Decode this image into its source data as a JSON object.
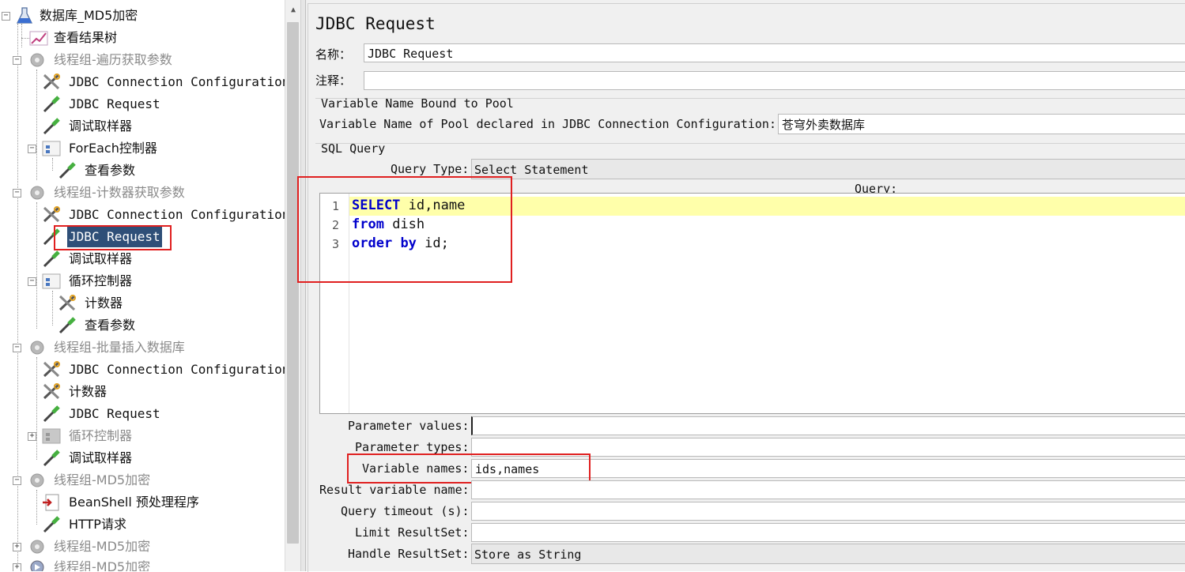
{
  "tree": {
    "root": "数据库_MD5加密",
    "items": [
      {
        "label": "查看结果树"
      },
      {
        "label": "线程组-遍历获取参数"
      },
      {
        "label": "JDBC Connection Configuration"
      },
      {
        "label": "JDBC Request"
      },
      {
        "label": "调试取样器"
      },
      {
        "label": "ForEach控制器"
      },
      {
        "label": "查看参数"
      },
      {
        "label": "线程组-计数器获取参数"
      },
      {
        "label": "JDBC Connection Configuration"
      },
      {
        "label": "JDBC Request"
      },
      {
        "label": "调试取样器"
      },
      {
        "label": "循环控制器"
      },
      {
        "label": "计数器"
      },
      {
        "label": "查看参数"
      },
      {
        "label": "线程组-批量插入数据库"
      },
      {
        "label": "JDBC Connection Configuration"
      },
      {
        "label": "计数器"
      },
      {
        "label": "JDBC Request"
      },
      {
        "label": "循环控制器"
      },
      {
        "label": "调试取样器"
      },
      {
        "label": "线程组-MD5加密"
      },
      {
        "label": "BeanShell 预处理程序"
      },
      {
        "label": "HTTP请求"
      },
      {
        "label": "线程组-MD5加密"
      },
      {
        "label": "线程组-MD5加密"
      }
    ]
  },
  "panel": {
    "title": "JDBC Request",
    "name_label": "名称：",
    "name_value": "JDBC Request",
    "comment_label": "注释：",
    "comment_value": "",
    "pool_group_title": "Variable Name Bound to Pool",
    "pool_label": "Variable Name of Pool declared in JDBC Connection Configuration:",
    "pool_value": "苍穹外卖数据库",
    "sql_group_title": "SQL Query",
    "query_type_label": "Query Type:",
    "query_type_value": "Select Statement",
    "query_label": "Query:",
    "code": {
      "line_numbers": [
        "1",
        "2",
        "3"
      ],
      "line1_kw": "SELECT",
      "line1_rest": " id,name",
      "line2_kw": "from",
      "line2_rest": " dish",
      "line3_kw1": "order",
      "line3_kw2": "by",
      "line3_rest": " id;"
    },
    "param_values_label": "Parameter values:",
    "param_values_value": "",
    "param_types_label": "Parameter types:",
    "param_types_value": "",
    "var_names_label": "Variable names:",
    "var_names_value": "ids,names",
    "result_var_label": "Result variable name:",
    "result_var_value": "",
    "timeout_label": "Query timeout (s):",
    "timeout_value": "",
    "limit_label": "Limit ResultSet:",
    "limit_value": "",
    "handle_label": "Handle ResultSet:",
    "handle_value": "Store as String"
  }
}
